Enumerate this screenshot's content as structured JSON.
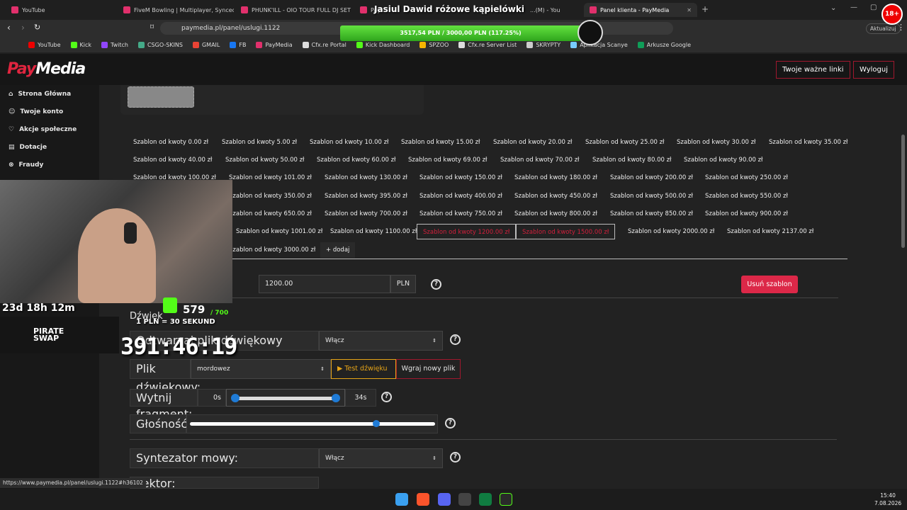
{
  "browser": {
    "tabs": [
      {
        "label": "YouTube"
      },
      {
        "label": "FiveM Bowling | Multiplayer, Synced"
      },
      {
        "label": "PHUNK'ILL - OIO TOUR FULL DJ SET"
      },
      {
        "label": "Pay"
      },
      {
        "label": "...(M) - You"
      },
      {
        "label": "Panel klienta - PayMedia"
      }
    ],
    "url": "paymedia.pl/panel/uslugi.1122",
    "update_label": "Aktualizuj",
    "bookmarks": [
      "YouTube",
      "Kick",
      "Twitch",
      "CSGO-SKINS",
      "GMAIL",
      "FB",
      "PayMedia",
      "Cfx.re Portal",
      "Kick Dashboard",
      "SPZOO",
      "Cfx.re Server List",
      "SKRYPTY",
      "Aplikacja Scanye",
      "Arkusze Google"
    ],
    "status_url": "https://www.paymedia.pl/panel/uslugi.1122#h36102"
  },
  "stream_overlay": {
    "banner_title": "Jasiul Dawid różowe kąpielówki",
    "goal_text": "3517,54 PLN / 3000,00 PLN (117.25%)",
    "goal_progress": 1.0,
    "timer_days": "23d 18h 12m",
    "kick_count": "579",
    "kick_goal": "/ 700",
    "pln_rule": "1 PLN = 30 SEKUND",
    "countdown": "391:46:19",
    "sponsor": "PIRATE SWAP",
    "age_badge": "18+"
  },
  "site": {
    "logo_pay": "Pay",
    "logo_media": "Media",
    "header_links": [
      "Twoje ważne linki",
      "Wyloguj"
    ],
    "nav": [
      {
        "label": "Strona Główna",
        "icon": "home-icon"
      },
      {
        "label": "Twoje konto",
        "icon": "user-icon"
      },
      {
        "label": "Akcje społeczne",
        "icon": "heart-icon"
      },
      {
        "label": "Dotacje",
        "icon": "document-icon"
      },
      {
        "label": "Fraudy",
        "icon": "block-icon"
      }
    ],
    "templates": [
      "Szablon od kwoty 0.00 zł",
      "Szablon od kwoty 5.00 zł",
      "Szablon od kwoty 10.00 zł",
      "Szablon od kwoty 15.00 zł",
      "Szablon od kwoty 20.00 zł",
      "Szablon od kwoty 25.00 zł",
      "Szablon od kwoty 30.00 zł",
      "Szablon od kwoty 35.00 zł",
      "Szablon od kwoty 40.00 zł",
      "Szablon od kwoty 50.00 zł",
      "Szablon od kwoty 60.00 zł",
      "Szablon od kwoty 69.00 zł",
      "Szablon od kwoty 70.00 zł",
      "Szablon od kwoty 80.00 zł",
      "Szablon od kwoty 90.00 zł",
      "Szablon od kwoty 100.00 zł",
      "Szablon od kwoty 101.00 zł",
      "Szablon od kwoty 130.00 zł",
      "Szablon od kwoty 150.00 zł",
      "Szablon od kwoty 180.00 zł",
      "Szablon od kwoty 200.00 zł",
      "Szablon od kwoty 250.00 zł",
      "Szablon od kwoty 350.00 zł",
      "Szablon od kwoty 395.00 zł",
      "Szablon od kwoty 400.00 zł",
      "Szablon od kwoty 450.00 zł",
      "Szablon od kwoty 500.00 zł",
      "Szablon od kwoty 550.00 zł",
      "Szablon od kwoty 650.00 zł",
      "Szablon od kwoty 700.00 zł",
      "Szablon od kwoty 750.00 zł",
      "Szablon od kwoty 800.00 zł",
      "Szablon od kwoty 850.00 zł",
      "Szablon od kwoty 900.00 zł",
      "Szablon od kwoty 1001.00 zł",
      "Szablon od kwoty 1100.00 zł",
      "Szablon od kwoty 1200.00 zł",
      "Szablon od kwoty 1500.00 zł",
      "Szablon od kwoty 2000.00 zł",
      "Szablon od kwoty 2137.00 zł",
      "Szablon od kwoty 3000.00 zł"
    ],
    "add_label": "+ dodaj",
    "amount_value": "1200.00",
    "currency": "PLN",
    "delete_label": "Usuń szablon",
    "sound_section": "Dźwięk",
    "sound_play_label": "Odtwarzaj plik dźwiękowy",
    "sound_play_value": "Włącz",
    "sound_file_label": "Plik dźwiękowy:",
    "sound_file_value": "mordowez",
    "test_sound": "Test dźwięku",
    "upload_new": "Wgraj nowy plik",
    "trim_label": "Wytnij fragment:",
    "trim_start": "0s",
    "trim_end": "34s",
    "trim_start_fraction": 0.0,
    "trim_end_fraction": 1.0,
    "volume_label": "Głośność:76%",
    "volume_fraction": 0.76,
    "tts_label": "Syntezator mowy:",
    "tts_value": "Włącz",
    "lector_label": "Lektor:"
  },
  "taskbar": {
    "time": "15:40",
    "date": "7.08.2026"
  },
  "colors": {
    "accent": "#d21f3c",
    "brand_red": "#e0253f"
  }
}
